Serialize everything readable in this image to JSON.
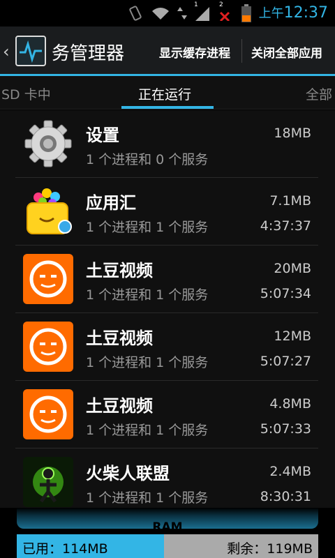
{
  "status_bar": {
    "time_prefix": "上午",
    "time": "12:37",
    "sim1_label": "1",
    "sim2_label": "2"
  },
  "action_bar": {
    "title": "务管理器",
    "action_show_cached": "显示缓存进程",
    "action_close_all": "关闭全部应用"
  },
  "tabs": {
    "left": "SD 卡中",
    "center": "正在运行",
    "right": "全部"
  },
  "apps": [
    {
      "name": "设置",
      "desc": "1 个进程和 0 个服务",
      "size": "18MB",
      "time": "",
      "icon": "settings-gear-icon"
    },
    {
      "name": "应用汇",
      "desc": "1 个进程和 1 个服务",
      "size": "7.1MB",
      "time": "4:37:37",
      "icon": "appchina-basket-icon"
    },
    {
      "name": "土豆视频",
      "desc": "1 个进程和 1 个服务",
      "size": "20MB",
      "time": "5:07:34",
      "icon": "tudou-icon"
    },
    {
      "name": "土豆视频",
      "desc": "1 个进程和 1 个服务",
      "size": "12MB",
      "time": "5:07:27",
      "icon": "tudou-icon"
    },
    {
      "name": "土豆视频",
      "desc": "1 个进程和 1 个服务",
      "size": "4.8MB",
      "time": "5:07:33",
      "icon": "tudou-icon"
    },
    {
      "name": "火柴人联盟",
      "desc": "1 个进程和 1 个服务",
      "size": "2.4MB",
      "time": "8:30:31",
      "icon": "stickman-game-icon"
    }
  ],
  "ram": {
    "label": "RAM",
    "used_text": "已用：114MB",
    "free_text": "剩余：119MB",
    "used_fraction": 0.489
  },
  "colors": {
    "accent": "#33b5e5",
    "tudou": "#ff6b00"
  }
}
